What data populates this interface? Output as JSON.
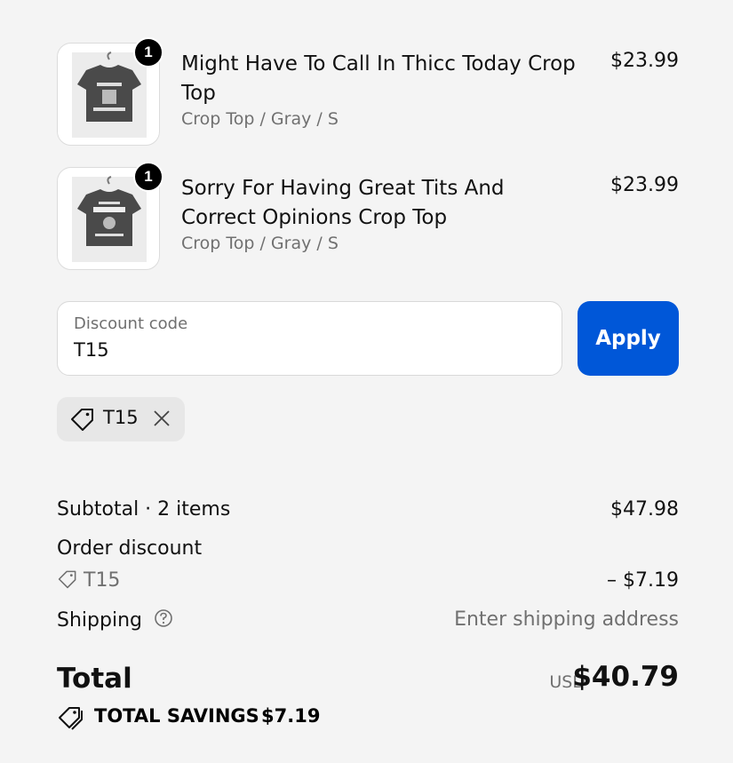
{
  "line_items": [
    {
      "quantity": "1",
      "title": "Might Have To Call In Thicc Today Crop Top",
      "variant": "Crop Top / Gray / S",
      "price": "$23.99"
    },
    {
      "quantity": "1",
      "title": "Sorry For Having Great Tits And Correct Opinions Crop Top",
      "variant": "Crop Top / Gray / S",
      "price": "$23.99"
    }
  ],
  "discount": {
    "label": "Discount code",
    "value": "T15",
    "apply_label": "Apply",
    "applied_code": "T15"
  },
  "summary": {
    "subtotal_label": "Subtotal · 2 items",
    "subtotal_value": "$47.98",
    "order_discount_label": "Order discount",
    "order_discount_code": "T15",
    "order_discount_value": "– $7.19",
    "shipping_label": "Shipping",
    "shipping_value": "Enter shipping address",
    "total_label": "Total",
    "total_currency": "USD",
    "total_value": "$40.79",
    "savings_label": "TOTAL SAVINGS",
    "savings_value": "$7.19"
  },
  "colors": {
    "accent": "#0057d8",
    "background": "#f4f4f4",
    "badge": "#000000"
  }
}
